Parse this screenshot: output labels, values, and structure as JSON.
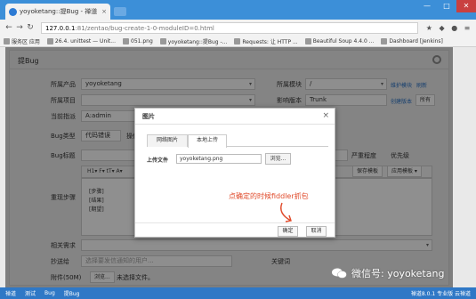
{
  "browser": {
    "tab_title": "yoyoketang::提Bug - 禅道",
    "tab_close": "×",
    "url_host": "127.0.0.1",
    "url_rest": ":81/zentao/bug-create-1-0-moduleID=0.html",
    "window_controls": [
      "—",
      "□",
      "✕"
    ],
    "bookmarks": [
      "服务区 应用",
      "26.4. unittest — Unit...",
      "051.png",
      "yoyoketang::提Bug -...",
      "Requests: 让 HTTP ...",
      "Beautiful Soup 4.4.0 ...",
      "Dashboard [Jenkins]"
    ]
  },
  "page": {
    "title": "提Bug",
    "rows": {
      "product": {
        "label": "所属产品",
        "value": "yoyoketang"
      },
      "module": {
        "label": "所属模块",
        "value": "/",
        "link1": "维护模块",
        "link2": "刷新"
      },
      "project": {
        "label": "所属项目",
        "value": ""
      },
      "version": {
        "label": "影响版本",
        "value": "Trunk",
        "link1": "创建版本",
        "link2": "所有"
      },
      "assignee": {
        "label": "当前指派",
        "value": "A:admin"
      },
      "bugtype": {
        "label": "Bug类型",
        "value": "代码错误",
        "os": "操作"
      },
      "title": {
        "label": "Bug标题",
        "severity_label": "严重程度",
        "priority_label": "优先级"
      },
      "steps": {
        "label": "重现步骤",
        "toolbar": "H1▾  F▾  tT▾  A▾",
        "save_tpl": "保存模板",
        "apply_tpl": "应用模板 ▾",
        "lines": [
          "[步骤]",
          "[结果]",
          "[期望]"
        ]
      },
      "related": {
        "label": "相关需求"
      },
      "cc": {
        "label": "抄送给",
        "placeholder": "选择要发信通知的用户...",
        "keyword": "关键词"
      },
      "attach": {
        "label": "附件(50M)",
        "browse": "浏览...",
        "none": "未选择文件。"
      }
    }
  },
  "modal": {
    "title": "图片",
    "close": "×",
    "tab_network": "网络图片",
    "tab_local": "本地上传",
    "file_label": "上传文件",
    "file_value": "yoyoketang.png",
    "browse": "浏览...",
    "annotation": "点确定的时候fiddler抓包",
    "ok": "确定",
    "cancel": "取消"
  },
  "statusbar": {
    "items": [
      "禅道",
      "测试",
      "Bug",
      "提Bug"
    ],
    "right": "禅道8.0.1  专业版  云禅道"
  },
  "watermark": {
    "text": "微信号: yoyoketang"
  }
}
